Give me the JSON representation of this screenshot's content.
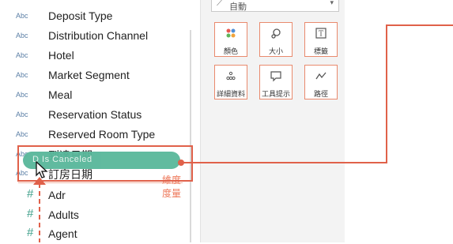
{
  "fields": {
    "dimensions": [
      {
        "type": "Abc",
        "label": "Deposit Type"
      },
      {
        "type": "Abc",
        "label": "Distribution Channel"
      },
      {
        "type": "Abc",
        "label": "Hotel"
      },
      {
        "type": "Abc",
        "label": "Market Segment"
      },
      {
        "type": "Abc",
        "label": "Meal"
      },
      {
        "type": "Abc",
        "label": "Reservation Status"
      },
      {
        "type": "Abc",
        "label": "Reserved Room Type"
      },
      {
        "type": "Abc",
        "label": "到達日期"
      },
      {
        "type": "Abc",
        "label": "訂房日期"
      }
    ],
    "measures": [
      {
        "type": "#",
        "label": "Adr"
      },
      {
        "type": "#",
        "label": "Adults"
      },
      {
        "type": "#",
        "label": "Agent"
      }
    ],
    "dimension_group_label": "維度",
    "measure_group_label": "度量"
  },
  "drag": {
    "pill_text": "Is Canceled",
    "pill_prefix": "D"
  },
  "marks": {
    "type_select": "自動",
    "buttons": [
      {
        "label": "顏色",
        "icon": "color-dots-icon"
      },
      {
        "label": "大小",
        "icon": "size-icon"
      },
      {
        "label": "標籤",
        "icon": "text-label-icon"
      },
      {
        "label": "詳細資料",
        "icon": "detail-icon"
      },
      {
        "label": "工具提示",
        "icon": "tooltip-icon"
      },
      {
        "label": "路徑",
        "icon": "path-icon"
      }
    ]
  },
  "colors": {
    "accent": "#e0614a",
    "pill": "#58b79a",
    "measure_hash": "#3e9f8a"
  }
}
